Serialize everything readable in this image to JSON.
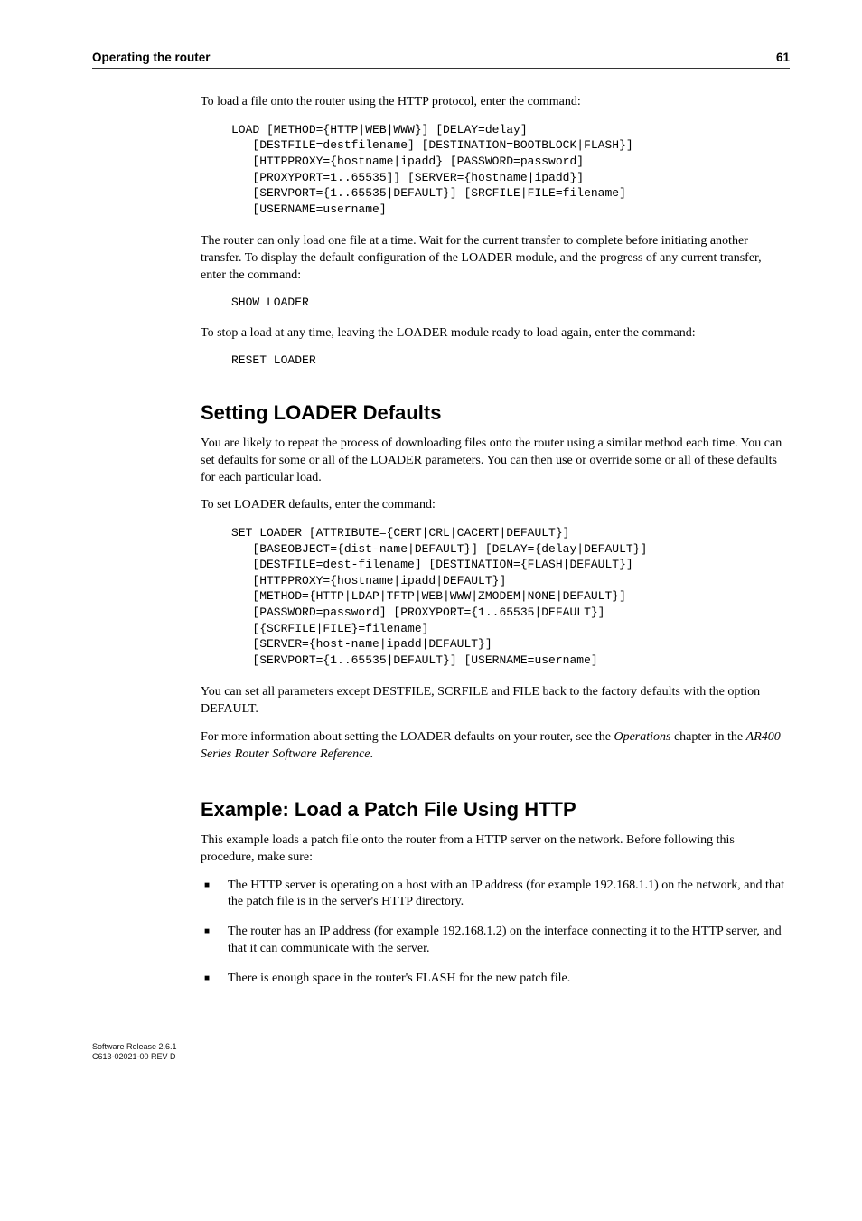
{
  "header": {
    "left": "Operating the router",
    "right": "61"
  },
  "p1": "To load a file onto the router using the HTTP protocol, enter the command:",
  "code1": "LOAD [METHOD={HTTP|WEB|WWW}] [DELAY=delay]\n   [DESTFILE=destfilename] [DESTINATION=BOOTBLOCK|FLASH}]\n   [HTTPPROXY={hostname|ipadd} [PASSWORD=password]\n   [PROXYPORT=1..65535]] [SERVER={hostname|ipadd}]\n   [SERVPORT={1..65535|DEFAULT}] [SRCFILE|FILE=filename]\n   [USERNAME=username]",
  "p2": "The router can only load one file at a time. Wait for the current transfer to complete before initiating another transfer. To display the default configuration of the LOADER module, and the progress of any current transfer, enter the command:",
  "code2": "SHOW LOADER",
  "p3": "To stop a load at any time, leaving the LOADER module ready to load again, enter the command:",
  "code3": "RESET LOADER",
  "section1": "Setting LOADER Defaults",
  "p4": "You are likely to repeat the process of downloading files onto the router using a similar method each time. You can set defaults for some or all of the LOADER parameters. You can then use or override some or all of these defaults for each particular load.",
  "p5": "To set LOADER defaults, enter the command:",
  "code4": "SET LOADER [ATTRIBUTE={CERT|CRL|CACERT|DEFAULT}]\n   [BASEOBJECT={dist-name|DEFAULT}] [DELAY={delay|DEFAULT}]\n   [DESTFILE=dest-filename] [DESTINATION={FLASH|DEFAULT}]\n   [HTTPPROXY={hostname|ipadd|DEFAULT}]\n   [METHOD={HTTP|LDAP|TFTP|WEB|WWW|ZMODEM|NONE|DEFAULT}]\n   [PASSWORD=password] [PROXYPORT={1..65535|DEFAULT}]\n   [{SCRFILE|FILE}=filename]\n   [SERVER={host-name|ipadd|DEFAULT}]\n   [SERVPORT={1..65535|DEFAULT}] [USERNAME=username]",
  "p6": "You can set all parameters except DESTFILE, SCRFILE and FILE back to the factory defaults with the option DEFAULT.",
  "p7_a": "For more information about setting the LOADER defaults on your router, see the ",
  "p7_b": "Operations",
  "p7_c": " chapter in the ",
  "p7_d": "AR400 Series Router Software Reference",
  "p7_e": ".",
  "section2": "Example: Load a Patch File Using HTTP",
  "p8": "This example loads a patch file onto the router from a HTTP server on the network. Before following this procedure, make sure:",
  "bullets": {
    "b1": "The HTTP server is operating on a host with an IP address (for example 192.168.1.1) on the network, and that the patch file is in the server's HTTP directory.",
    "b2": "The router has an IP address (for example 192.168.1.2) on the interface connecting it to the HTTP server, and that it can communicate with the server.",
    "b3": "There is enough space in the router's FLASH for the new patch file."
  },
  "footnote": {
    "l1": "Software Release 2.6.1",
    "l2": "C613-02021-00 REV D"
  }
}
